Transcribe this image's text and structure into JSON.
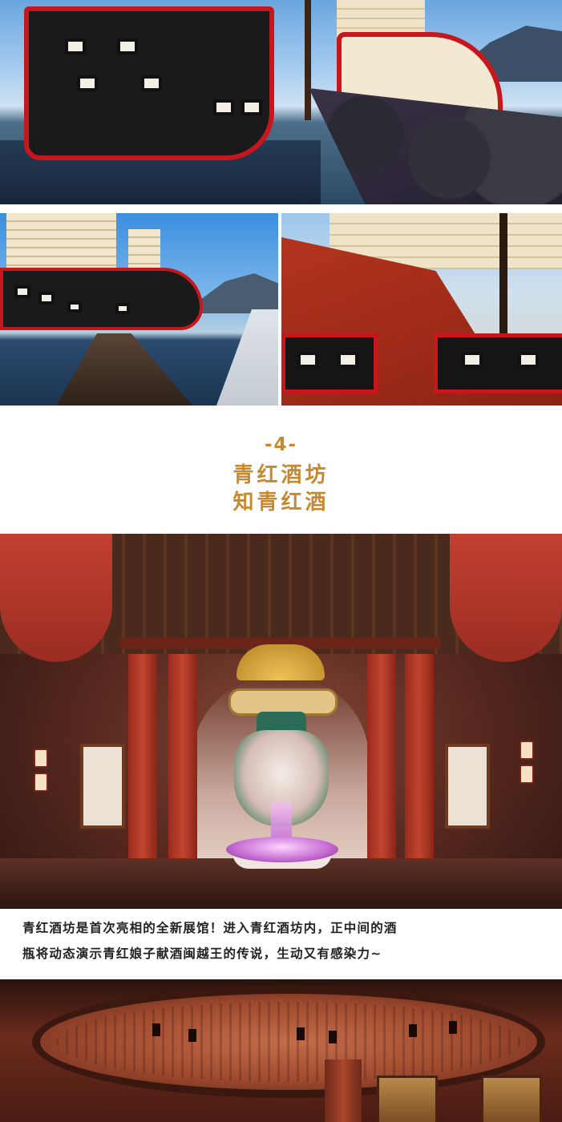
{
  "section": {
    "number": "-4-",
    "title_line_1": "青红酒坊",
    "title_line_2": "知青红酒"
  },
  "caption": {
    "line_1": "青红酒坊是首次亮相的全新展馆！进入青红酒坊内，正中间的酒",
    "line_2": "瓶将动态演示青红娘子献酒闽越王的传说，生动又有感染力~"
  },
  "colors": {
    "heading": "#c8892e",
    "caption_text": "#222222",
    "ship_red": "#c8161d",
    "ship_black": "#1a1a1a"
  }
}
